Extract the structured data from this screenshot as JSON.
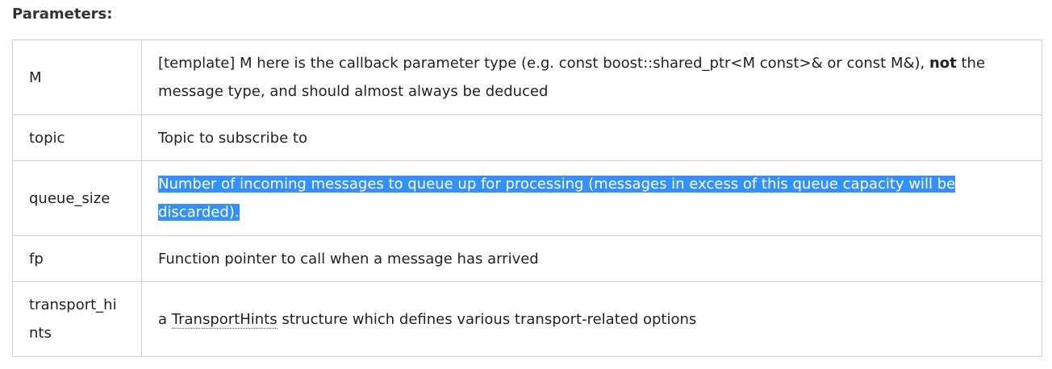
{
  "heading": "Parameters:",
  "rows": [
    {
      "name": "M",
      "desc_a": "[template] M here is the callback parameter type (e.g. const boost::shared_ptr<M const>& or const M&), ",
      "desc_bold": "not",
      "desc_b": " the message type, and should almost always be deduced"
    },
    {
      "name": "topic",
      "desc": "Topic to subscribe to"
    },
    {
      "name": "queue_size",
      "desc": "Number of incoming messages to queue up for processing (messages in excess of this queue capacity will be discarded)."
    },
    {
      "name": "fp",
      "desc": "Function pointer to call when a message has arrived"
    },
    {
      "name": "transport_hints",
      "desc_a": "a ",
      "desc_link": "TransportHints",
      "desc_b": " structure which defines various transport-related options"
    }
  ],
  "colors": {
    "selection": "#3390ff",
    "border": "#cfcfcf"
  }
}
